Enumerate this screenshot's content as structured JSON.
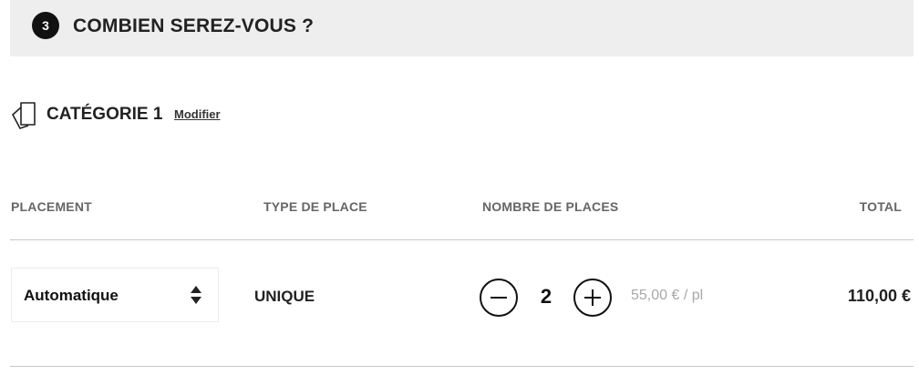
{
  "step": {
    "number": "3",
    "title": "COMBIEN SEREZ-VOUS ?"
  },
  "category": {
    "icon": "ticket-icon",
    "label": "CATÉGORIE 1",
    "modify_label": "Modifier"
  },
  "table": {
    "headers": {
      "placement": "PLACEMENT",
      "type": "TYPE DE PLACE",
      "quantity": "NOMBRE DE PLACES",
      "total": "TOTAL"
    },
    "row": {
      "placement": "Automatique",
      "type": "UNIQUE",
      "quantity": "2",
      "unit_price": "55,00 € / pl",
      "total": "110,00 €"
    }
  },
  "icons": {
    "decrement": "minus-circle-icon",
    "increment": "plus-circle-icon",
    "select": "sort-arrows-icon"
  }
}
